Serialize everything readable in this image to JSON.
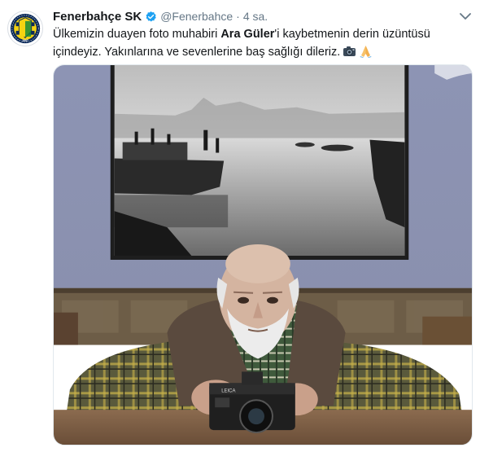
{
  "tweet": {
    "display_name": "Fenerbahçe SK",
    "handle": "@Fenerbahce",
    "separator": "·",
    "timestamp": "4 sa.",
    "text_part1": "Ülkemizin duayen foto muhabiri ",
    "text_bold": "Ara Güler",
    "text_part2": "'i kaybetmenin derin üzüntüsü içindeyiz. Yakınlarına ve sevenlerine baş sağlığı dileriz.",
    "emojis": [
      "camera-emoji",
      "folded-hands-emoji"
    ]
  },
  "avatar": {
    "logo_text_top": "FENERBAHÇE SPOR KULÜBÜ",
    "logo_year": "1907"
  },
  "photo_embedded_text": {
    "camera_brand": "LEICA"
  },
  "colors": {
    "verified_blue": "#1da1f2",
    "handle_gray": "#657786",
    "fb_yellow": "#f5d312",
    "fb_navy": "#0b2a5a"
  }
}
